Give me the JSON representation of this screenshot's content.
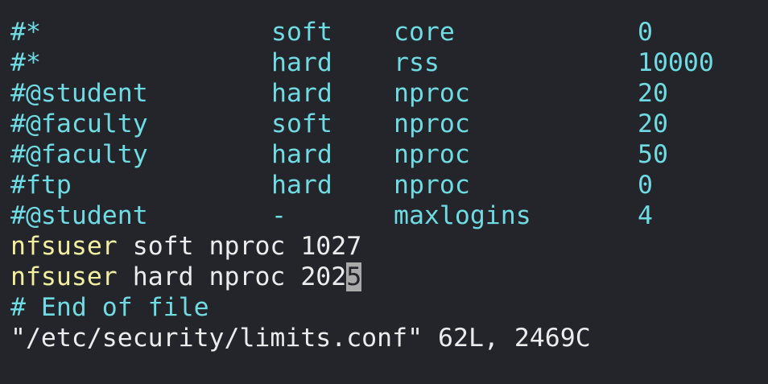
{
  "colors": {
    "background": "#24252b",
    "comment_cyan": "#6fdbe2",
    "user_yellow": "#f2f0a0",
    "plain_text": "#ececec",
    "cursor_block": "#a9a9a9"
  },
  "commented_rows": [
    {
      "domain": "#*",
      "type": "soft",
      "item": "core",
      "value": "0"
    },
    {
      "domain": "#*",
      "type": "hard",
      "item": "rss",
      "value": "10000"
    },
    {
      "domain": "#@student",
      "type": "hard",
      "item": "nproc",
      "value": "20"
    },
    {
      "domain": "#@faculty",
      "type": "soft",
      "item": "nproc",
      "value": "20"
    },
    {
      "domain": "#@faculty",
      "type": "hard",
      "item": "nproc",
      "value": "50"
    },
    {
      "domain": "#ftp",
      "type": "hard",
      "item": "nproc",
      "value": "0"
    },
    {
      "domain": "#@student",
      "type": "-",
      "item": "maxlogins",
      "value": "4"
    }
  ],
  "active_rows": [
    {
      "user": "nfsuser",
      "rest": " soft nproc 1027",
      "cursor_char": ""
    },
    {
      "user": "nfsuser",
      "rest": " hard nproc 202",
      "cursor_char": "5"
    }
  ],
  "end_comment": "# End of file",
  "status_line": "\"/etc/security/limits.conf\" 62L, 2469C"
}
